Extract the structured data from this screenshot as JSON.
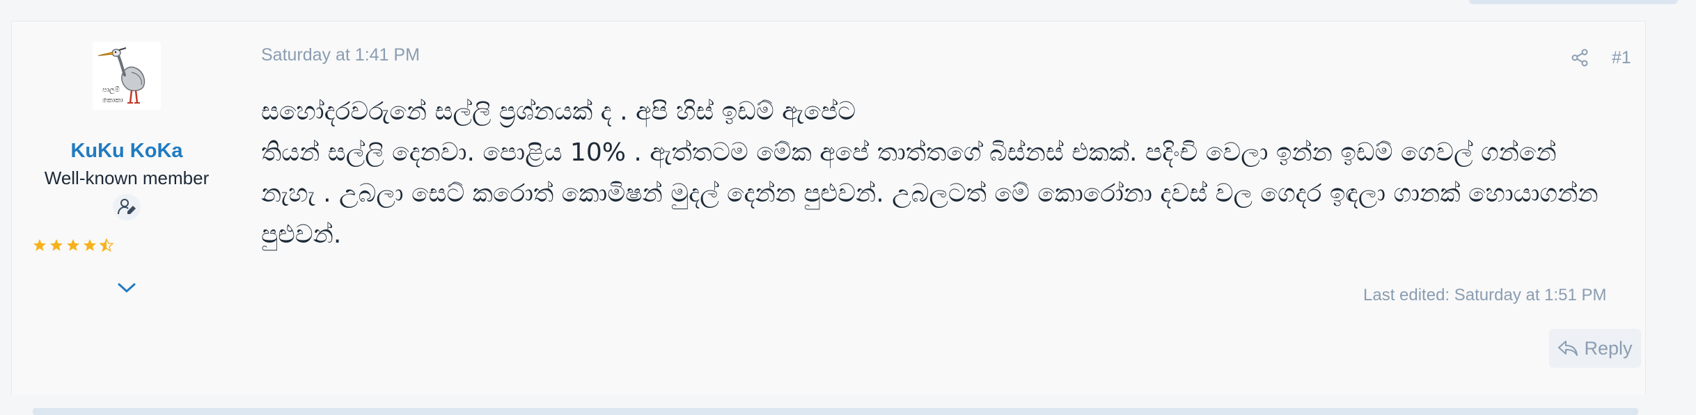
{
  "post": {
    "user": {
      "name": "KuKu KoKa",
      "title": "Well-known member",
      "avatar_caption_line1": "පාලම්",
      "avatar_caption_line2": "කොකා",
      "rating": 4.5
    },
    "date": "Saturday at 1:41 PM",
    "number": "#1",
    "body": [
      "සහෝදරවරුනේ සල්ලි ප්‍රශ්නයක් ද . අපි හිස් ඉඩම් ඇපේට",
      "තියන් සල්ලි දෙනවා. පොළිය 10% . ඇත්තටම මේක අපේ තාත්තගේ බිස්නස් එකක්. පදිංචි වෙලා ඉන්න ඉඩම් ගෙවල් ගන්නේ නැහැ . උබලා සෙට් කරොත් කොමිෂන් මුදල් දෙන්න පුළුවන්. උබලටත් මේ කොරෝනා දවස් වල ගෙදර ඉඳලා ගානක් හොයාගන්න පුළුවන්."
    ],
    "last_edited": "Last edited: Saturday at 1:51 PM",
    "reply_label": "Reply"
  },
  "colors": {
    "username": "#1f7bc1",
    "muted_text": "#8a9db2",
    "body_text": "#1d2a38",
    "star": "#f6b21b"
  },
  "icons": {
    "share": "share-icon",
    "badge": "user-edit-icon",
    "expand": "chevron-down-icon",
    "reply": "reply-arrow-icon"
  }
}
